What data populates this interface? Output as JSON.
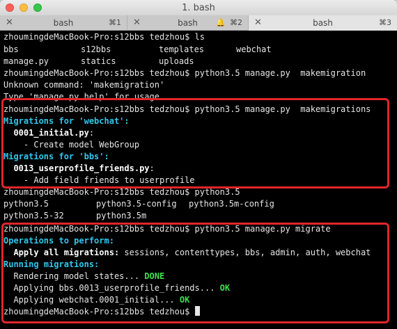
{
  "window": {
    "title": "1. bash"
  },
  "tabs": [
    {
      "label": "bash",
      "shortcut": "⌘1"
    },
    {
      "label": "bash",
      "shortcut": "⌘2"
    },
    {
      "label": "bash",
      "shortcut": "⌘3"
    }
  ],
  "terminal": {
    "prompt": "zhoumingdeMacBook-Pro:s12bbs tedzhou$",
    "cmd_ls": " ls",
    "ls_row1": [
      "bbs",
      "s12bbs",
      "templates",
      "webchat"
    ],
    "ls_row2": [
      "manage.py",
      "statics",
      "uploads"
    ],
    "cmd_makemigration": " python3.5 manage.py  makemigration",
    "unknown_cmd": "Unknown command: 'makemigration'",
    "type_help": "Type 'manage.py help' for usage.",
    "cmd_makemigrations": " python3.5 manage.py  makemigrations",
    "mig_webchat": "Migrations for 'webchat':",
    "mig_webchat_file": "0001_initial.py",
    "colon": ":",
    "mig_webchat_action": "    - Create model WebGroup",
    "mig_bbs": "Migrations for 'bbs':",
    "mig_bbs_file": "0013_userprofile_friends.py",
    "mig_bbs_action": "    - Add field friends to userprofile",
    "cmd_python": " python3.5",
    "py_row1": [
      "python3.5",
      "python3.5-config",
      "python3.5m-config"
    ],
    "py_row2": [
      "python3.5-32",
      "python3.5m"
    ],
    "cmd_migrate": " python3.5 manage.py migrate",
    "ops_title": "Operations to perform:",
    "apply_all_label": "Apply all migrations:",
    "apply_all_apps": " sessions, contenttypes, bbs, admin, auth, webchat",
    "running_title": "Running migrations:",
    "render_state": "  Rendering model states...",
    "apply_bbs": "  Applying bbs.0013_userprofile_friends...",
    "apply_webchat": "  Applying webchat.0001_initial...",
    "done": " DONE",
    "ok": " OK"
  },
  "colors": {
    "highlight_box": "#e0262b",
    "cyan": "#31c7ee",
    "green": "#3de04a"
  }
}
